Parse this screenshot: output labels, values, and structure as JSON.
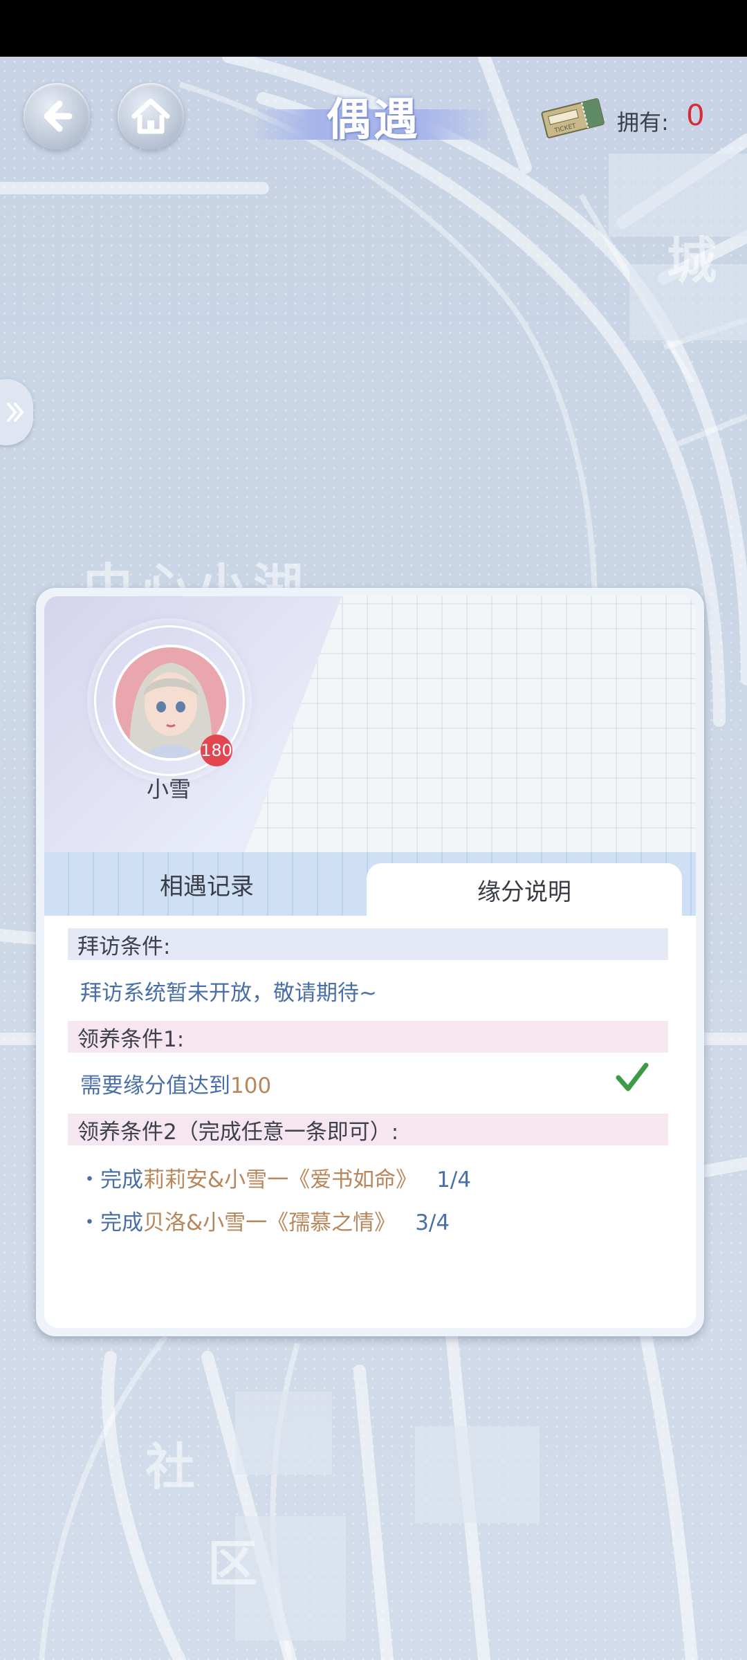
{
  "header": {
    "title": "偶遇",
    "back_icon": "arrow-left-icon",
    "home_icon": "home-icon",
    "ticket_icon": "ticket-icon",
    "own_label": "拥有:",
    "own_count": "0"
  },
  "map": {
    "labels": [
      "城",
      "中心小湖",
      "社",
      "区"
    ]
  },
  "character": {
    "name": "小雪",
    "level": "180"
  },
  "tabs": [
    {
      "label": "相遇记录",
      "active": false
    },
    {
      "label": "缘分说明",
      "active": true
    }
  ],
  "conditions": {
    "visit_title": "拜访条件:",
    "visit_text": "拜访系统暂未开放，敬请期待~",
    "adopt1_title": "领养条件1:",
    "adopt1_text_a": "需要缘分值达到",
    "adopt1_text_b": "100",
    "adopt1_done": true,
    "adopt2_title": "领养条件2（完成任意一条即可）:",
    "tasks": [
      {
        "bullet": "・",
        "prefix": "完成",
        "name": "莉莉安&小雪一《爱书如命》",
        "progress": "1/4"
      },
      {
        "bullet": "・",
        "prefix": "完成",
        "name": "贝洛&小雪一《孺慕之情》",
        "progress": "3/4"
      }
    ]
  },
  "colors": {
    "accent_blue": "#4a6fa8",
    "accent_orange": "#b8865b",
    "count_red": "#d62c3a",
    "check_green": "#3f9a47"
  }
}
